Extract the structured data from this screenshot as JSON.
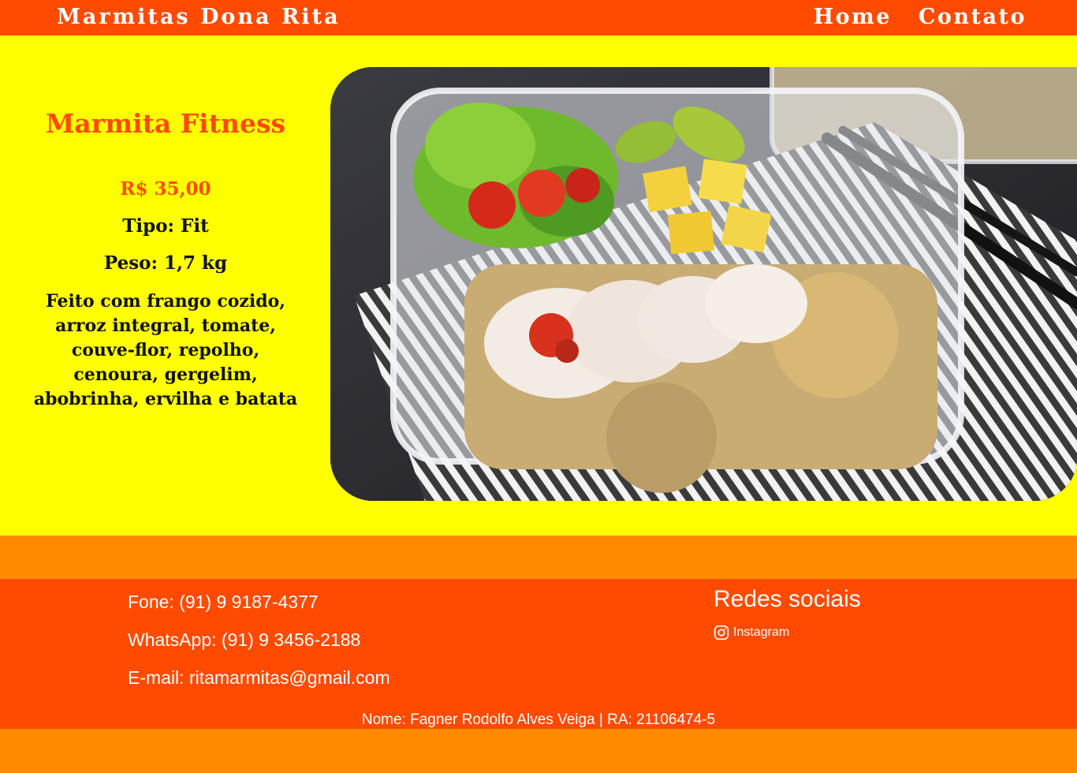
{
  "header": {
    "brand": "Marmitas Dona Rita",
    "nav": [
      {
        "label": "Home"
      },
      {
        "label": "Contato"
      }
    ]
  },
  "product": {
    "title": "Marmita Fitness",
    "price": "R$ 35,00",
    "type": "Tipo: Fit",
    "weight": "Peso: 1,7 kg",
    "description": "Feito com frango cozido, arroz integral, tomate, couve-flor, repolho, cenoura, gergelim, abobrinha, ervilha e batata",
    "image_alt": "Marmita fitness com frango, salada, frutas e arroz integral"
  },
  "footer": {
    "phone": "Fone: (91) 9 9187-4377",
    "whatsapp": "WhatsApp: (91) 9 3456-2188",
    "email": "E-mail: ritamarmitas@gmail.com",
    "social_title": "Redes sociais",
    "instagram_label": "Instagram",
    "credit": "Nome: Fagner Rodolfo Alves Veiga | RA: 21106474-5"
  },
  "colors": {
    "header_bg": "#ff4a00",
    "main_bg": "#ffff00",
    "strip_bg": "#ff8a00",
    "title_color": "#ff4a00"
  },
  "icons": {
    "social": "instagram-icon"
  }
}
